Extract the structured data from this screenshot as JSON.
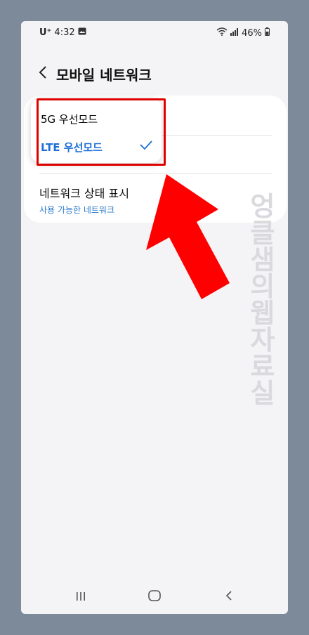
{
  "status_bar": {
    "carrier": "U⁺",
    "time": "4:32",
    "battery": "46%"
  },
  "header": {
    "title": "모바일 네트워크"
  },
  "menu": {
    "options": [
      {
        "label": "5G 우선모드",
        "selected": false
      },
      {
        "label": "LTE 우선모드",
        "selected": true
      }
    ]
  },
  "settings": {
    "network_status": {
      "title": "네트워크 상태 표시",
      "subtitle": "사용 가능한 네트워크"
    }
  },
  "watermark": {
    "text": "엉클샘의웹자료실"
  },
  "colors": {
    "accent": "#1b6fd6",
    "subtitle": "#2a78c9",
    "highlight": "#e10000",
    "arrow": "#ff0000",
    "background": "#7d8a99"
  },
  "icons": {
    "back": "chevron-left-icon",
    "check": "check-icon",
    "nav_recents": "recents-icon",
    "nav_home": "home-icon",
    "nav_back": "back-icon"
  }
}
